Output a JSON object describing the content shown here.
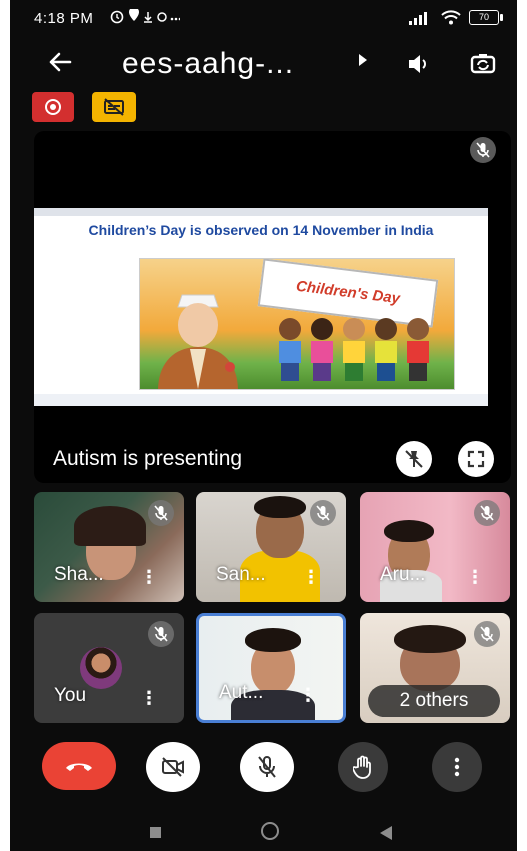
{
  "status_bar": {
    "time": "4:18 PM",
    "battery": "70"
  },
  "header": {
    "meeting_title": "ees-aahg-..."
  },
  "presentation": {
    "slide_title": "Children’s Day is observed on 14 November in India",
    "banner_text": "Children's Day",
    "presenting_label": "Autism  is presenting"
  },
  "participants": [
    {
      "name": "Sha...",
      "muted": true
    },
    {
      "name": "San...",
      "muted": true
    },
    {
      "name": "Aru...",
      "muted": true
    },
    {
      "name": "You",
      "muted": true
    },
    {
      "name": "Aut...",
      "muted": false
    },
    {
      "name": "2 others",
      "muted": true
    }
  ],
  "controls": [
    "end-call",
    "camera-off",
    "mic-off",
    "raise-hand",
    "more-options"
  ],
  "colors": {
    "background": "#0c0c0c",
    "end_call": "#ea4335",
    "record": "#d32f2f",
    "captions": "#f4b400",
    "active_speaker_border": "#4a7fd4",
    "slide_title": "#1f4aa0"
  },
  "icons": {
    "back": "arrow-left-icon",
    "speaker": "speaker-icon",
    "switch_camera": "switch-camera-icon",
    "record": "record-icon",
    "captions": "captions-off-icon",
    "mic_off": "mic-off-icon"
  }
}
